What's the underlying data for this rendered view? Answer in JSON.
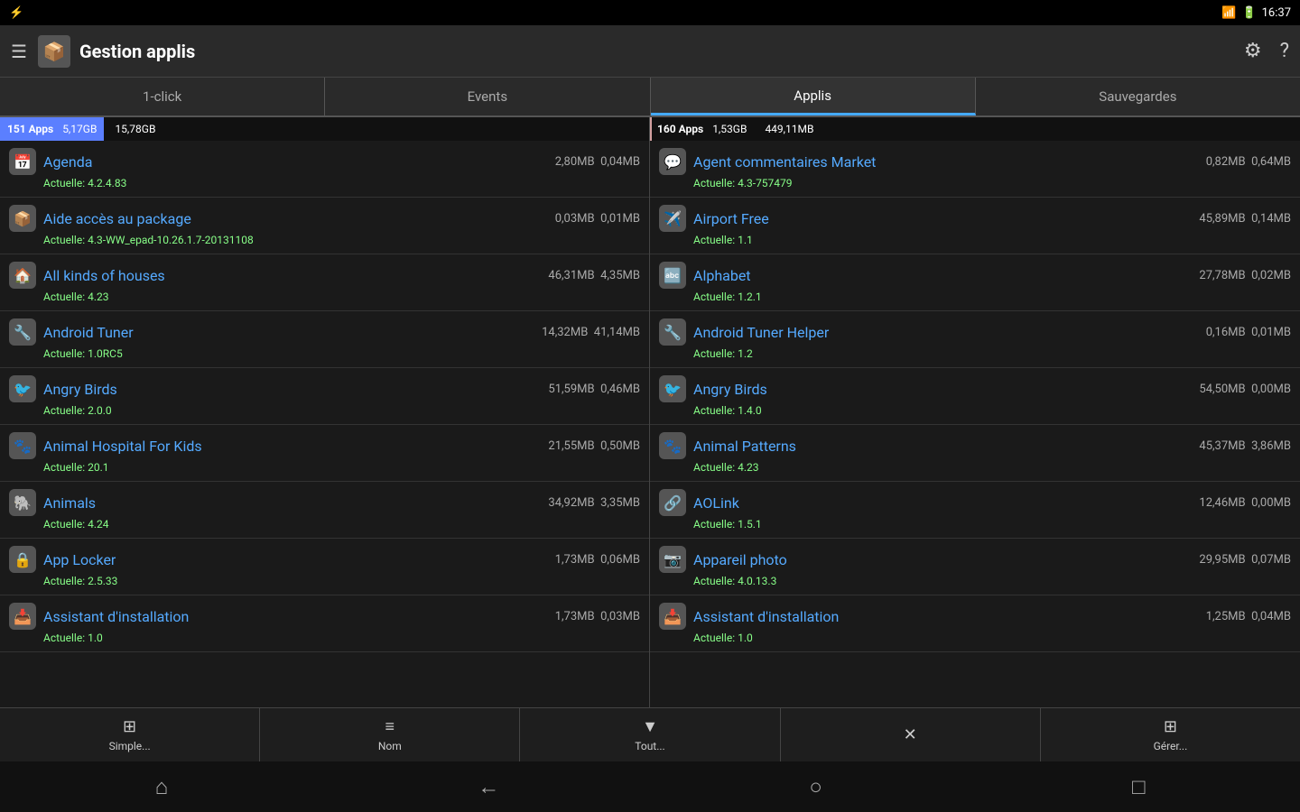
{
  "status": {
    "battery_icon": "⚡",
    "wifi_icon": "📶",
    "battery_level": "🔋",
    "time": "16:37"
  },
  "header": {
    "menu_icon": "☰",
    "app_icon": "📦",
    "title": "Gestion applis",
    "filter_icon": "⚙",
    "help_icon": "?"
  },
  "tabs": [
    {
      "id": "1click",
      "label": "1-click",
      "active": false
    },
    {
      "id": "events",
      "label": "Events",
      "active": false
    },
    {
      "id": "applis",
      "label": "Applis",
      "active": true
    },
    {
      "id": "sauvegardes",
      "label": "Sauvegardes",
      "active": false
    }
  ],
  "storage": {
    "left": {
      "count": "151 Apps",
      "size": "5,17GB",
      "fill_pct": 16,
      "right_label": "15,78GB"
    },
    "right": {
      "count": "160 Apps",
      "size": "1,53GB",
      "fill_pct": 0.3,
      "right_label": "449,11MB"
    }
  },
  "left_apps": [
    {
      "icon": "📅",
      "name": "Agenda",
      "size1": "2,80MB",
      "size2": "0,04MB",
      "version": "Actuelle: 4.2.4.83"
    },
    {
      "icon": "📦",
      "name": "Aide accès au package",
      "size1": "0,03MB",
      "size2": "0,01MB",
      "version": "Actuelle: 4.3-WW_epad-10.26.1.7-20131108"
    },
    {
      "icon": "🏠",
      "name": "All kinds of houses",
      "size1": "46,31MB",
      "size2": "4,35MB",
      "version": "Actuelle: 4.23"
    },
    {
      "icon": "🔧",
      "name": "Android Tuner",
      "size1": "14,32MB",
      "size2": "41,14MB",
      "version": "Actuelle: 1.0RC5"
    },
    {
      "icon": "🐦",
      "name": "Angry Birds",
      "size1": "51,59MB",
      "size2": "0,46MB",
      "version": "Actuelle: 2.0.0"
    },
    {
      "icon": "🐾",
      "name": "Animal Hospital For Kids",
      "size1": "21,55MB",
      "size2": "0,50MB",
      "version": "Actuelle: 20.1"
    },
    {
      "icon": "🐘",
      "name": "Animals",
      "size1": "34,92MB",
      "size2": "3,35MB",
      "version": "Actuelle: 4.24"
    },
    {
      "icon": "🔒",
      "name": "App Locker",
      "size1": "1,73MB",
      "size2": "0,06MB",
      "version": "Actuelle: 2.5.33"
    },
    {
      "icon": "📥",
      "name": "Assistant d'installation",
      "size1": "1,73MB",
      "size2": "0,03MB",
      "version": "Actuelle: 1.0"
    }
  ],
  "right_apps": [
    {
      "icon": "💬",
      "name": "Agent commentaires Market",
      "size1": "0,82MB",
      "size2": "0,64MB",
      "version": "Actuelle: 4.3-757479"
    },
    {
      "icon": "✈️",
      "name": "Airport Free",
      "size1": "45,89MB",
      "size2": "0,14MB",
      "version": "Actuelle: 1.1"
    },
    {
      "icon": "🔤",
      "name": "Alphabet",
      "size1": "27,78MB",
      "size2": "0,02MB",
      "version": "Actuelle: 1.2.1"
    },
    {
      "icon": "🔧",
      "name": "Android Tuner Helper",
      "size1": "0,16MB",
      "size2": "0,01MB",
      "version": "Actuelle: 1.2"
    },
    {
      "icon": "🐦",
      "name": "Angry Birds",
      "size1": "54,50MB",
      "size2": "0,00MB",
      "version": "Actuelle: 1.4.0"
    },
    {
      "icon": "🐾",
      "name": "Animal Patterns",
      "size1": "45,37MB",
      "size2": "3,86MB",
      "version": "Actuelle: 4.23"
    },
    {
      "icon": "🔗",
      "name": "AOLink",
      "size1": "12,46MB",
      "size2": "0,00MB",
      "version": "Actuelle: 1.5.1"
    },
    {
      "icon": "📷",
      "name": "Appareil photo",
      "size1": "29,95MB",
      "size2": "0,07MB",
      "version": "Actuelle: 4.0.13.3"
    },
    {
      "icon": "📥",
      "name": "Assistant d'installation",
      "size1": "1,25MB",
      "size2": "0,04MB",
      "version": "Actuelle: 1.0"
    }
  ],
  "toolbar": [
    {
      "icon": "⊞",
      "label": "Simple..."
    },
    {
      "icon": "≡↕",
      "label": "Nom"
    },
    {
      "icon": "▼",
      "label": "Tout..."
    },
    {
      "icon": "✕",
      "label": ""
    },
    {
      "icon": "⊞",
      "label": "Gérer..."
    }
  ],
  "nav": {
    "home_up": "⌂",
    "back": "←",
    "home": "○",
    "recent": "□"
  }
}
